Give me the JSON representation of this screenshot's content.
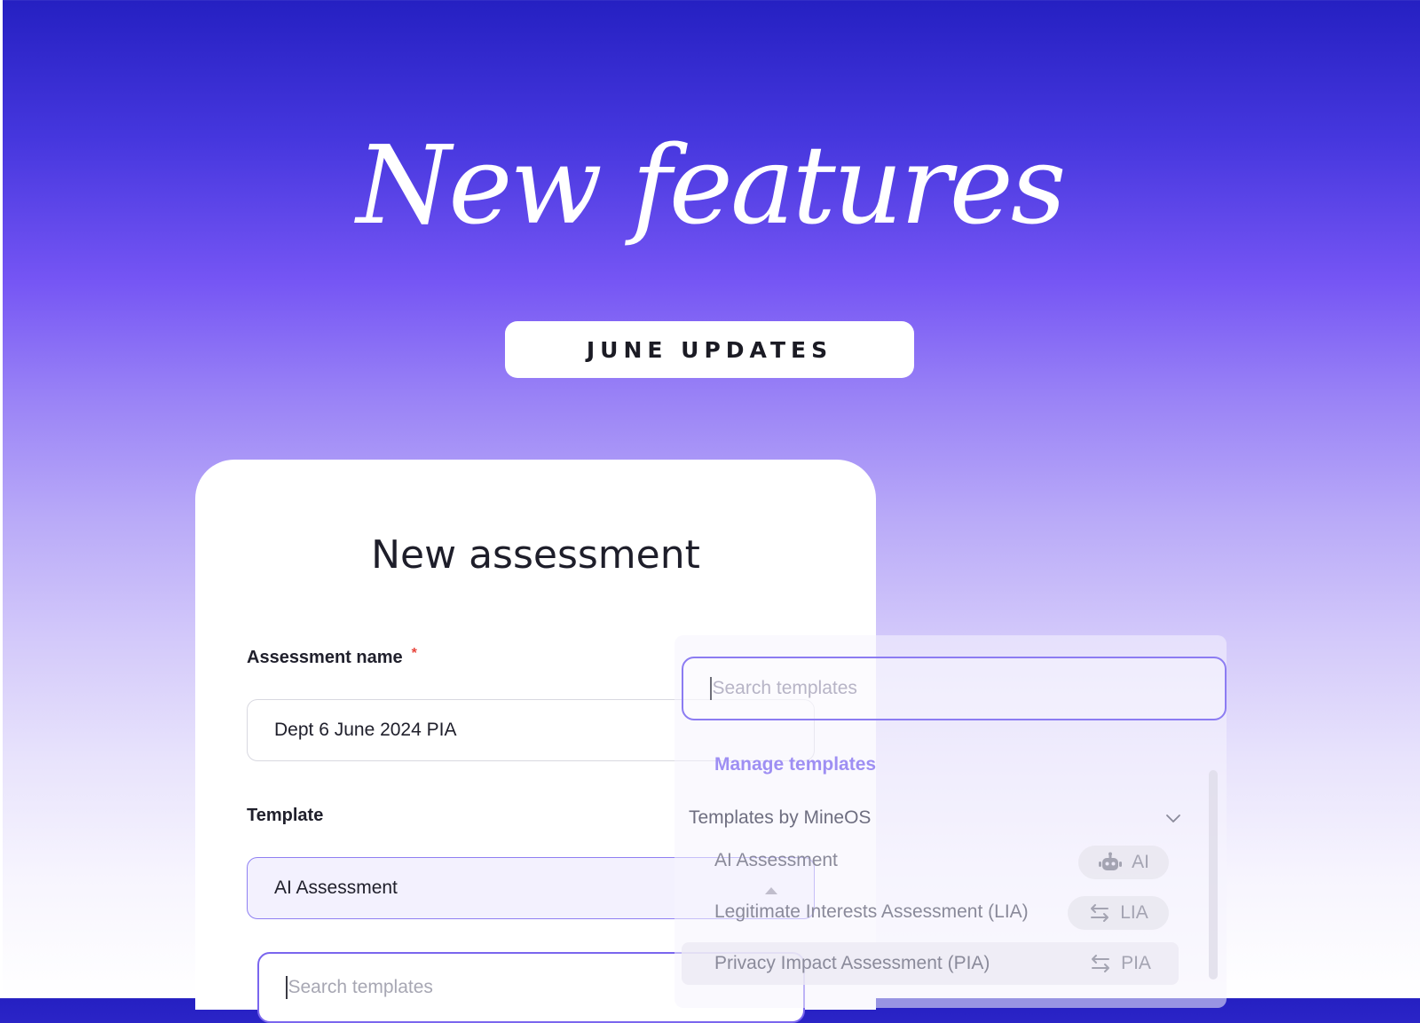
{
  "hero": {
    "title": "New features",
    "badge": "JUNE UPDATES"
  },
  "card": {
    "title": "New assessment",
    "name_label": "Assessment name",
    "required_mark": "*",
    "name_value": "Dept 6 June 2024 PIA",
    "template_label": "Template",
    "template_value": "AI Assessment",
    "search_placeholder": "Search templates"
  },
  "dropdown": {
    "search_placeholder": "Search templates",
    "manage_link": "Manage templates",
    "group_title": "Templates by MineOS",
    "options": [
      {
        "label": "AI Assessment",
        "tag": "AI",
        "icon": "robot-icon"
      },
      {
        "label": "Legitimate Interests Assessment (LIA)",
        "tag": "LIA",
        "icon": "arrows-exchange-icon"
      },
      {
        "label": "Privacy Impact Assessment (PIA)",
        "tag": "PIA",
        "icon": "arrows-exchange-icon"
      }
    ]
  },
  "colors": {
    "accent": "#7a66ee",
    "link": "#9e8ff3",
    "required": "#e8453c",
    "bg_top": "#2520c2"
  }
}
